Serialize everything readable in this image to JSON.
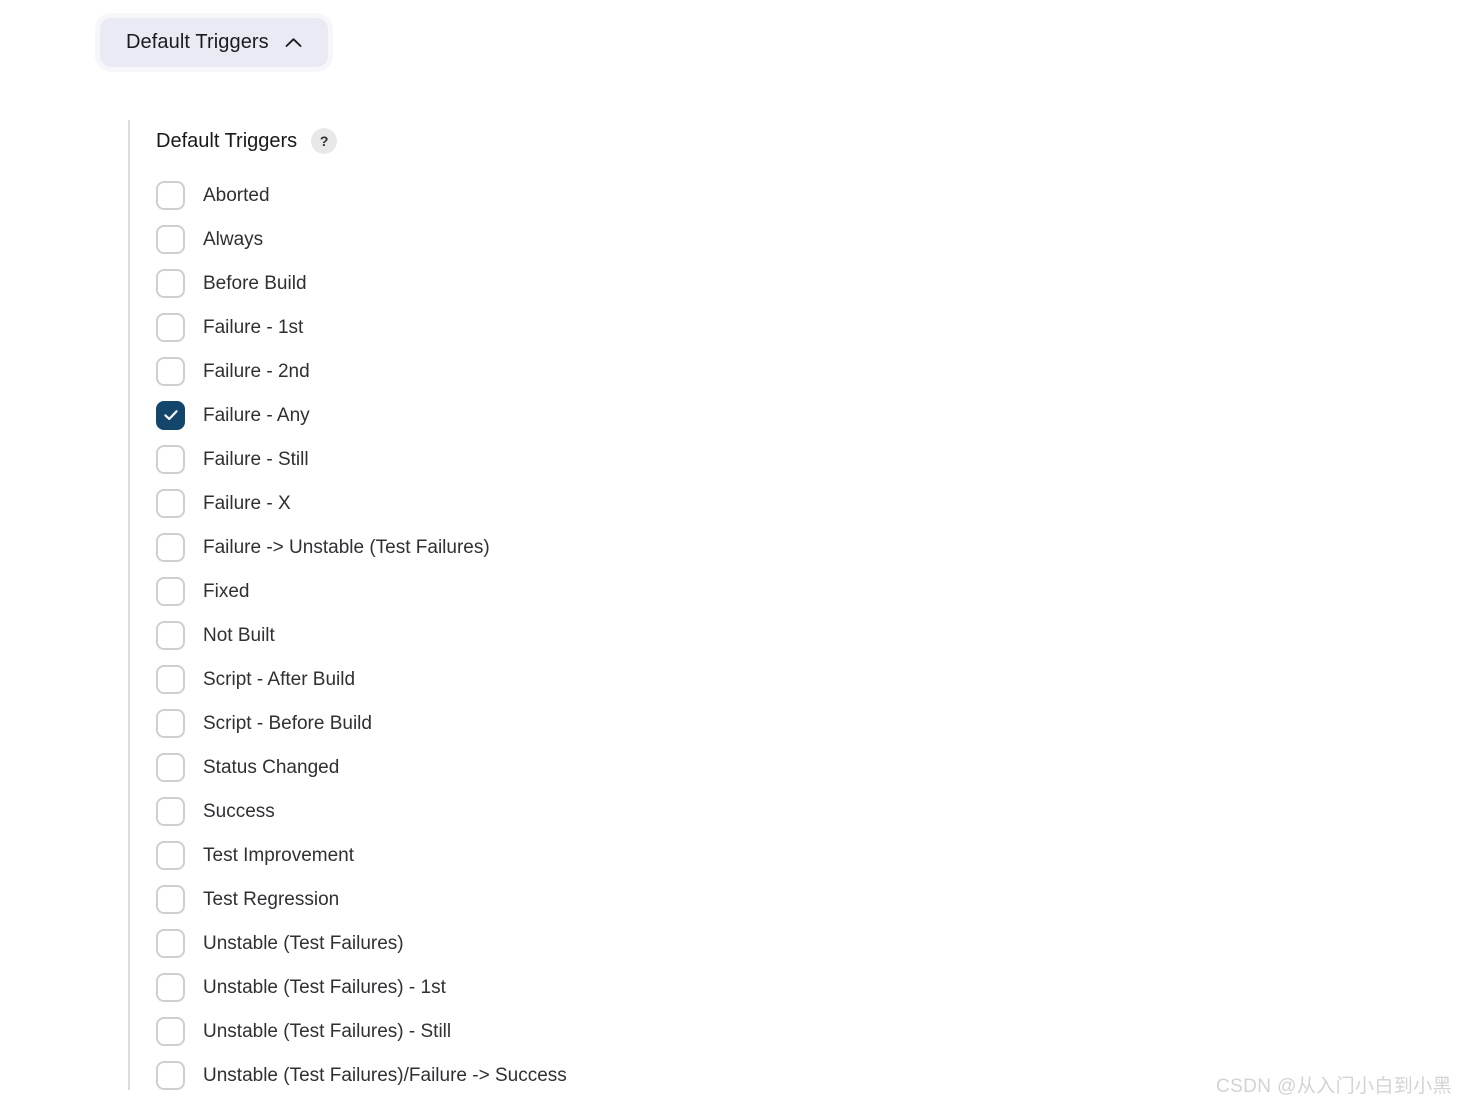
{
  "header": {
    "pill_label": "Default Triggers",
    "chevron_icon": "chevron-up-icon",
    "pill_bg": "#e9eaf4"
  },
  "section": {
    "title": "Default Triggers",
    "help_label": "?",
    "help_icon": "help-question-icon",
    "accent_checked": "#14466b",
    "border_color": "#cfcfd3",
    "options": [
      {
        "label": "Aborted",
        "checked": false
      },
      {
        "label": "Always",
        "checked": false
      },
      {
        "label": "Before Build",
        "checked": false
      },
      {
        "label": "Failure - 1st",
        "checked": false
      },
      {
        "label": "Failure - 2nd",
        "checked": false
      },
      {
        "label": "Failure - Any",
        "checked": true
      },
      {
        "label": "Failure - Still",
        "checked": false
      },
      {
        "label": "Failure - X",
        "checked": false
      },
      {
        "label": "Failure -> Unstable (Test Failures)",
        "checked": false
      },
      {
        "label": "Fixed",
        "checked": false
      },
      {
        "label": "Not Built",
        "checked": false
      },
      {
        "label": "Script - After Build",
        "checked": false
      },
      {
        "label": "Script - Before Build",
        "checked": false
      },
      {
        "label": "Status Changed",
        "checked": false
      },
      {
        "label": "Success",
        "checked": false
      },
      {
        "label": "Test Improvement",
        "checked": false
      },
      {
        "label": "Test Regression",
        "checked": false
      },
      {
        "label": "Unstable (Test Failures)",
        "checked": false
      },
      {
        "label": "Unstable (Test Failures) - 1st",
        "checked": false
      },
      {
        "label": "Unstable (Test Failures) - Still",
        "checked": false
      },
      {
        "label": "Unstable (Test Failures)/Failure -> Success",
        "checked": false
      }
    ]
  },
  "watermark": {
    "text": "CSDN @从入门小白到小黑"
  }
}
